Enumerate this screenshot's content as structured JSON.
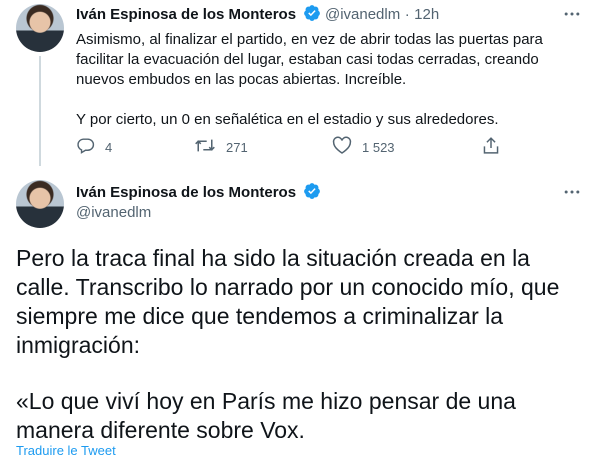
{
  "colors": {
    "accent": "#1d9bf0",
    "secondary_text": "#536471",
    "primary_text": "#0f1419"
  },
  "tweet1": {
    "author_name": "Iván Espinosa de los Monteros",
    "handle": "@ivanedlm",
    "separator": "·",
    "time": "12h",
    "text_lines": [
      "Asimismo, al finalizar el partido, en vez de abrir todas las puertas para",
      "facilitar la evacuación del lugar, estaban casi todas cerradas, creando",
      "nuevos embudos en las pocas abiertas. Increíble.",
      "Y por cierto, un 0 en señalética en el estadio y sus alrededores."
    ],
    "actions": {
      "replies": "4",
      "retweets": "271",
      "likes": "1 523"
    }
  },
  "tweet2": {
    "author_name": "Iván Espinosa de los Monteros",
    "handle": "@ivanedlm",
    "paragraph1_lines": [
      "Pero la traca final ha sido la situación creada en la",
      "calle. Transcribo lo narrado por un conocido mío, que",
      "siempre me dice que tendemos a criminalizar la",
      "inmigración:"
    ],
    "paragraph2_lines": [
      "«Lo que viví hoy en París me hizo pensar de una",
      "manera diferente sobre Vox."
    ],
    "translate_label": "Traduire le Tweet"
  },
  "icons": [
    "verified-badge-icon",
    "more-icon",
    "reply-icon",
    "retweet-icon",
    "like-icon",
    "share-icon"
  ]
}
